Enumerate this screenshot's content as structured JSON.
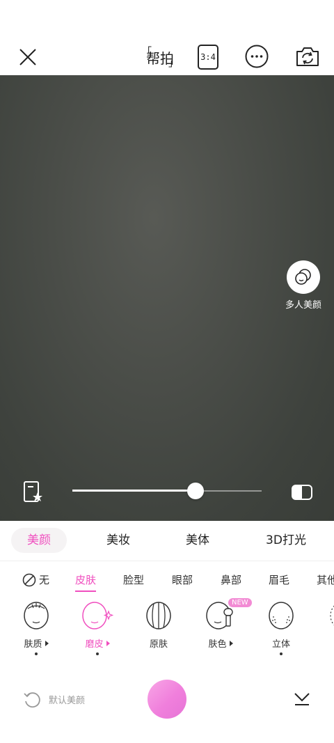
{
  "topbar": {
    "close_icon": "close-icon",
    "help_label": "帮拍",
    "ratio_label": "3:4",
    "more_icon": "more-icon",
    "flip_icon": "camera-flip-icon"
  },
  "preview": {
    "multi_beauty_label": "多人美颜",
    "intensity": 0.65
  },
  "category_tabs": [
    {
      "label": "美颜",
      "active": true
    },
    {
      "label": "美妆",
      "active": false
    },
    {
      "label": "美体",
      "active": false
    },
    {
      "label": "3D打光",
      "active": false
    }
  ],
  "sub_tabs": [
    {
      "label": "无"
    },
    {
      "label": "皮肤",
      "active": true
    },
    {
      "label": "脸型"
    },
    {
      "label": "眼部"
    },
    {
      "label": "鼻部"
    },
    {
      "label": "眉毛"
    },
    {
      "label": "其他"
    }
  ],
  "features": [
    {
      "label": "肤质",
      "active": false
    },
    {
      "label": "磨皮",
      "active": true
    },
    {
      "label": "原肤",
      "active": false
    },
    {
      "label": "肤色",
      "active": false,
      "badge": "NEW"
    },
    {
      "label": "立体",
      "active": false
    }
  ],
  "bottom": {
    "reset_label": "默认美颜"
  },
  "colors": {
    "accent": "#f04fbf",
    "preview_bg": "#4a4d48"
  }
}
